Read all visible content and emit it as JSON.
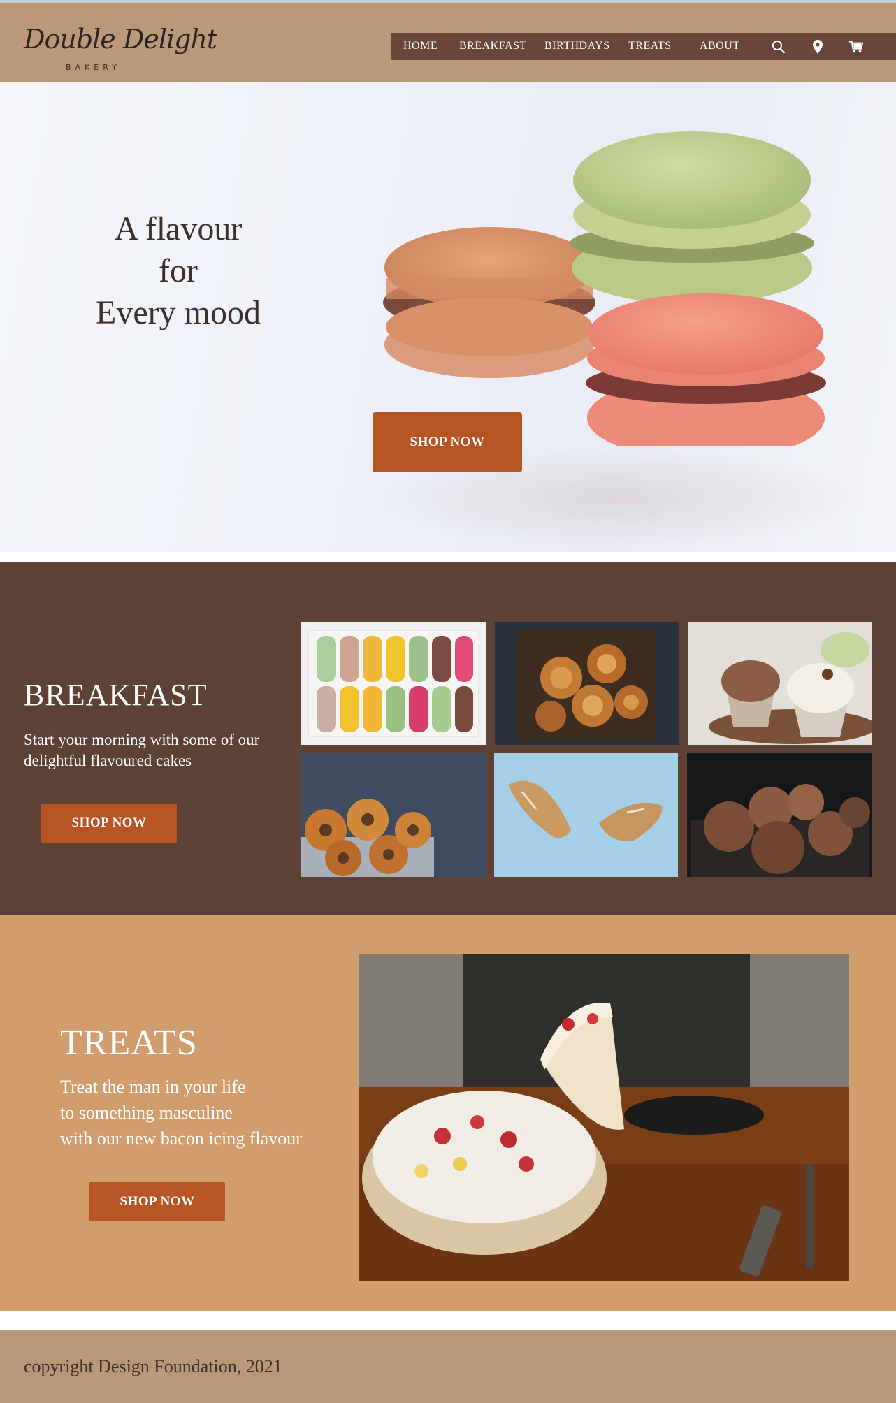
{
  "brand": {
    "name": "Double Delight",
    "subtitle": "BAKERY"
  },
  "nav": {
    "items": [
      "HOME",
      "BREAKFAST",
      "BIRTHDAYS",
      "TREATS",
      "ABOUT"
    ],
    "icons": [
      "search-icon",
      "location-pin-icon",
      "cart-icon"
    ]
  },
  "hero": {
    "heading_line1": "A flavour",
    "heading_line2": "for",
    "heading_line3": "Every mood",
    "button_label": "SHOP NOW",
    "image": "macarons"
  },
  "breakfast": {
    "title": "BREAKFAST",
    "text": "Start your morning with some of our delightful flavoured cakes",
    "button_label": "SHOP NOW",
    "images": [
      "macaron-box",
      "cinnamon-rolls",
      "cupcakes",
      "bundt-cakes",
      "baguette",
      "bread-loaves"
    ]
  },
  "treats": {
    "title": "TREATS",
    "text_line1": "Treat the man in your life",
    "text_line2": "to something masculine",
    "text_line3": "with our new bacon icing flavour",
    "button_label": "SHOP NOW",
    "image": "layer-cake-slice"
  },
  "footer": {
    "copyright": "copyright Design Foundation, 2021"
  },
  "colors": {
    "header": "#bb9877",
    "nav": "#6a4638",
    "accent": "#b65424",
    "breakfast_bg": "#5c4134",
    "treats_bg": "#d29d6d"
  }
}
